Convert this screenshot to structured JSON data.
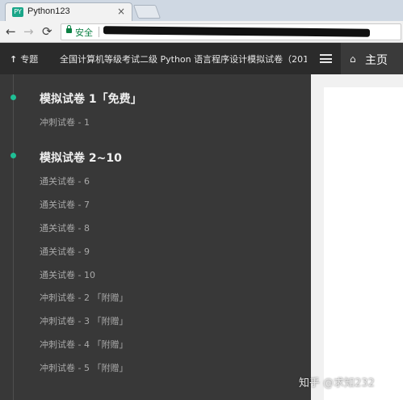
{
  "browser": {
    "tab_title": "Python123",
    "tab_close": "×",
    "tab_icon": "PY",
    "secure_label": "安全",
    "icons": {
      "back": "←",
      "forward": "→",
      "reload": "⟳"
    }
  },
  "header": {
    "topic_label": "专题",
    "topic_icon": "↑",
    "doc_title": "全国计算机等级考试二级 Python 语言程序设计模拟试卷（2018 ...",
    "home_label": "主页",
    "home_icon": "⌂"
  },
  "sidebar": {
    "sections": [
      {
        "title": "模拟试卷 1「免费」",
        "items": [
          "冲刺试卷 - 1"
        ]
      },
      {
        "title": "模拟试卷 2~10",
        "items": [
          "通关试卷 - 6",
          "通关试卷 - 7",
          "通关试卷 - 8",
          "通关试卷 - 9",
          "通关试卷 - 10",
          "冲刺试卷 - 2 「附赠」",
          "冲刺试卷 - 3 「附赠」",
          "冲刺试卷 - 4 「附赠」",
          "冲刺试卷 - 5 「附赠」"
        ]
      }
    ]
  },
  "watermark": "知乎 @求知232",
  "colors": {
    "accent": "#1fbf95",
    "sidebar_bg": "#383838",
    "header_bg": "#2b2b2b"
  }
}
